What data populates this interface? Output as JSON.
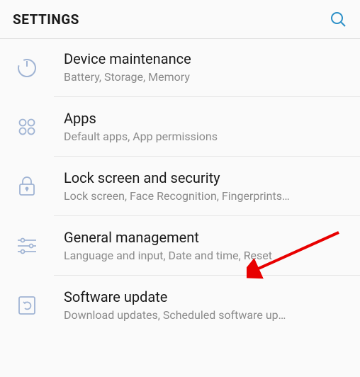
{
  "header": {
    "title": "SETTINGS"
  },
  "items": [
    {
      "icon": "device-maintenance-icon",
      "title": "Device maintenance",
      "subtitle": "Battery, Storage, Memory"
    },
    {
      "icon": "apps-icon",
      "title": "Apps",
      "subtitle": "Default apps, App permissions"
    },
    {
      "icon": "lock-icon",
      "title": "Lock screen and security",
      "subtitle": "Lock screen, Face Recognition, Fingerprints…"
    },
    {
      "icon": "sliders-icon",
      "title": "General management",
      "subtitle": "Language and input, Date and time, Reset"
    },
    {
      "icon": "software-update-icon",
      "title": "Software update",
      "subtitle": "Download updates, Scheduled software up…"
    }
  ],
  "icon_color": "#a0b4d4"
}
